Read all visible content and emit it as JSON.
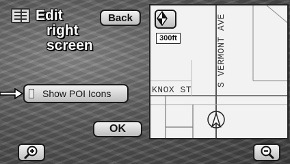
{
  "header": {
    "title_line1": "Edit",
    "title_line2": "right",
    "title_line3": "screen",
    "back_label": "Back"
  },
  "poi": {
    "label": "Show POI Icons"
  },
  "ok_label": "OK",
  "map": {
    "scale": "300ft",
    "streets": {
      "vertical": "S VERMONT AVE",
      "horizontal": "KNOX ST"
    }
  },
  "icons": {
    "list": "list-icon",
    "compass": "compass-icon",
    "zoom_in": "zoom-in-icon",
    "zoom_out": "zoom-out-icon",
    "pointer": "arrow-pointer-icon",
    "vehicle": "vehicle-position-icon"
  },
  "colors": {
    "background": "#5a5a5a",
    "button": "#d8d8d8",
    "map_background": "#f2f2f2"
  }
}
